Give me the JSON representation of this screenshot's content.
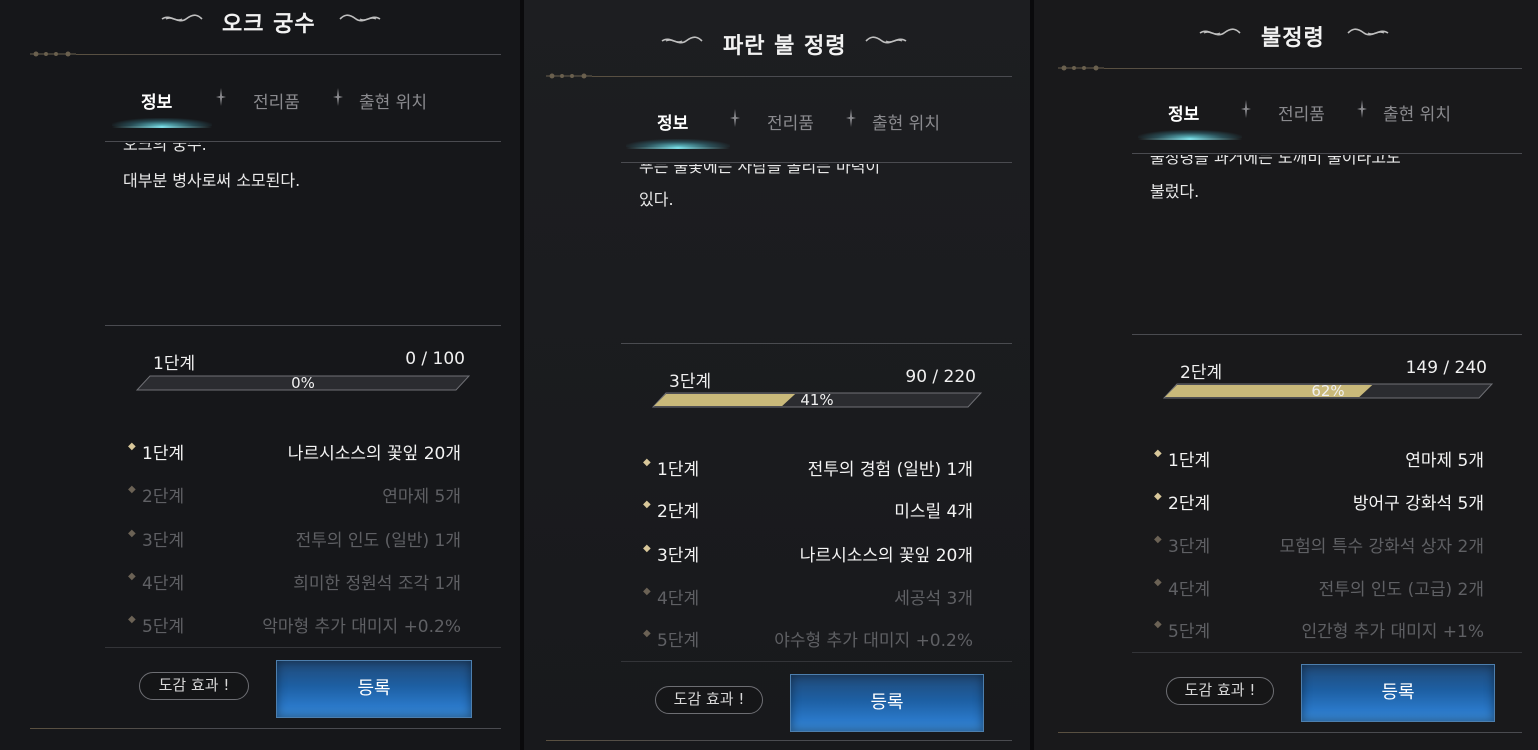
{
  "panels": [
    {
      "title": "오크 궁수",
      "tabs": [
        "정보",
        "전리품",
        "출현 위치"
      ],
      "description_clipped": "오크의 궁수.",
      "description": "대부분 병사로써 소모된다.",
      "stage": "1단계",
      "count": "0 / 100",
      "percent_text": "0%",
      "progress": 0.0,
      "rewards": [
        {
          "stage": "1단계",
          "item": "나르시소스의 꽃잎 20개",
          "unlocked": true
        },
        {
          "stage": "2단계",
          "item": "연마제 5개",
          "unlocked": false
        },
        {
          "stage": "3단계",
          "item": "전투의 인도 (일반) 1개",
          "unlocked": false
        },
        {
          "stage": "4단계",
          "item": "희미한 정원석 조각 1개",
          "unlocked": false
        },
        {
          "stage": "5단계",
          "item": "악마형 추가 대미지 +0.2%",
          "unlocked": false
        }
      ],
      "effect_label": "도감 효과 !",
      "register_label": "등록"
    },
    {
      "title": "파란 불 정령",
      "tabs": [
        "정보",
        "전리품",
        "출현 위치"
      ],
      "description_clipped": "푸는 불꽃에는 사람을 올리는 마력이",
      "description": "있다.",
      "stage": "3단계",
      "count": "90 / 220",
      "percent_text": "41%",
      "progress": 0.41,
      "rewards": [
        {
          "stage": "1단계",
          "item": "전투의 경험 (일반) 1개",
          "unlocked": true
        },
        {
          "stage": "2단계",
          "item": "미스릴 4개",
          "unlocked": true
        },
        {
          "stage": "3단계",
          "item": "나르시소스의 꽃잎 20개",
          "unlocked": true
        },
        {
          "stage": "4단계",
          "item": "세공석 3개",
          "unlocked": false
        },
        {
          "stage": "5단계",
          "item": "야수형 추가 대미지 +0.2%",
          "unlocked": false
        }
      ],
      "effect_label": "도감 효과 !",
      "register_label": "등록"
    },
    {
      "title": "불정령",
      "tabs": [
        "정보",
        "전리품",
        "출현 위치"
      ],
      "description_clipped": "불정령을 과거에는 도깨비 불이라고도",
      "description": "불렀다.",
      "stage": "2단계",
      "count": "149 / 240",
      "percent_text": "62%",
      "progress": 0.62,
      "rewards": [
        {
          "stage": "1단계",
          "item": "연마제 5개",
          "unlocked": true
        },
        {
          "stage": "2단계",
          "item": "방어구 강화석 5개",
          "unlocked": true
        },
        {
          "stage": "3단계",
          "item": "모험의 특수 강화석 상자 2개",
          "unlocked": false
        },
        {
          "stage": "4단계",
          "item": "전투의 인도 (고급) 2개",
          "unlocked": false
        },
        {
          "stage": "5단계",
          "item": "인간형 추가 대미지 +1%",
          "unlocked": false
        }
      ],
      "effect_label": "도감 효과 !",
      "register_label": "등록"
    }
  ],
  "colors": {
    "bar_fill": "#c9b97a",
    "bar_empty": "#2b2c30",
    "accent_glow": "#7fdde6",
    "register_blue": "#1d5fa3",
    "locked_text": "#5f6064"
  }
}
